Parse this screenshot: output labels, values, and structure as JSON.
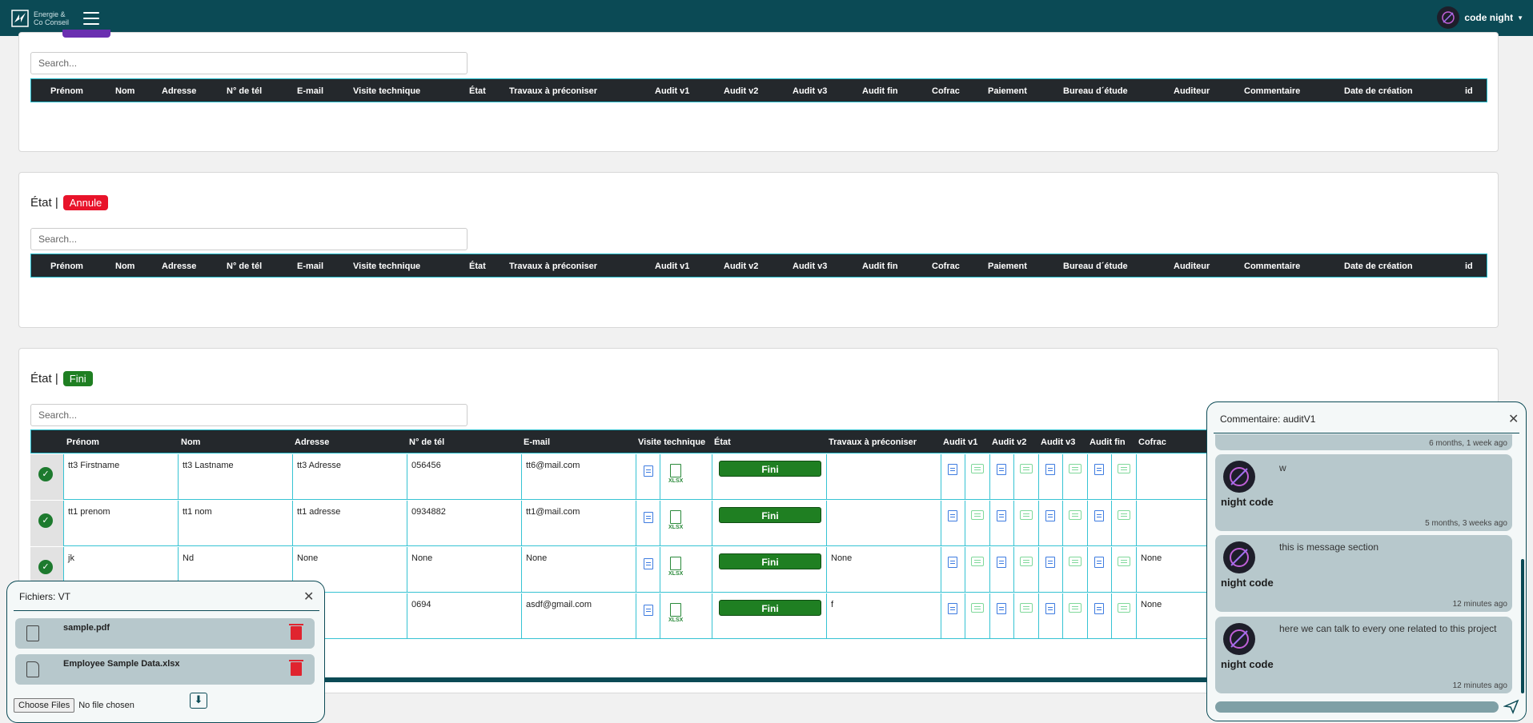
{
  "brand": {
    "line1": "Energie &",
    "line2": "Co Conseil"
  },
  "user": {
    "name": "code night"
  },
  "search_placeholder": "Search...",
  "columns_short": [
    "Prénom",
    "Nom",
    "Adresse",
    "N° de tél",
    "E-mail",
    "Visite technique",
    "État",
    "Travaux à préconiser",
    "Audit v1",
    "Audit v2",
    "Audit v3",
    "Audit fin",
    "Cofrac",
    "Paiement",
    "Bureau d´étude",
    "Auditeur",
    "Commentaire",
    "Date de création",
    "id"
  ],
  "section_annule": {
    "label": "État |",
    "badge": "Annule",
    "badge_color": "#e8132a"
  },
  "section_fini": {
    "label": "État |",
    "badge": "Fini",
    "badge_color": "#1f7f22"
  },
  "fini_columns": [
    "Prénom",
    "Nom",
    "Adresse",
    "N° de tél",
    "E-mail",
    "Visite technique",
    "État",
    "Travaux à préconiser",
    "Audit v1",
    "Audit v2",
    "Audit v3",
    "Audit fin",
    "Cofrac"
  ],
  "rows": [
    {
      "prenom": "tt3 Firstname",
      "nom": "tt3 Lastname",
      "adresse": "tt3 Adresse",
      "tel": "056456",
      "email": "tt6@mail.com",
      "xlsx": "XLSX",
      "etat": "Fini",
      "travaux": "",
      "cofrac": ""
    },
    {
      "prenom": "tt1 prenom",
      "nom": "tt1 nom",
      "adresse": "tt1 adresse",
      "tel": "0934882",
      "email": "tt1@mail.com",
      "xlsx": "XLSX",
      "etat": "Fini",
      "travaux": "",
      "cofrac": ""
    },
    {
      "prenom": "jk",
      "nom": "Nd",
      "adresse": "None",
      "tel": "None",
      "email": "None",
      "xlsx": "XLSX",
      "etat": "Fini",
      "travaux": "None",
      "cofrac": "None"
    },
    {
      "prenom": "",
      "nom": "",
      "adresse": "",
      "tel": "0694",
      "email": "asdf@gmail.com",
      "xlsx": "XLSX",
      "etat": "Fini",
      "travaux": "f",
      "cofrac": "None"
    }
  ],
  "files_panel": {
    "title": "Fichiers: VT",
    "files": [
      {
        "name": "sample.pdf"
      },
      {
        "name": "Employee Sample Data.xlsx"
      }
    ],
    "choose_label": "Choose Files",
    "no_file": "No file chosen"
  },
  "comment_panel": {
    "title": "Commentaire: auditV1",
    "top_time": "6 months, 1 week ago",
    "messages": [
      {
        "user": "night code",
        "text": "w",
        "time": "5 months, 3 weeks ago"
      },
      {
        "user": "night code",
        "text": "this is message section",
        "time": "12 minutes ago"
      },
      {
        "user": "night code",
        "text": "here we can talk to every one related to this project",
        "time": "12 minutes ago"
      }
    ]
  }
}
